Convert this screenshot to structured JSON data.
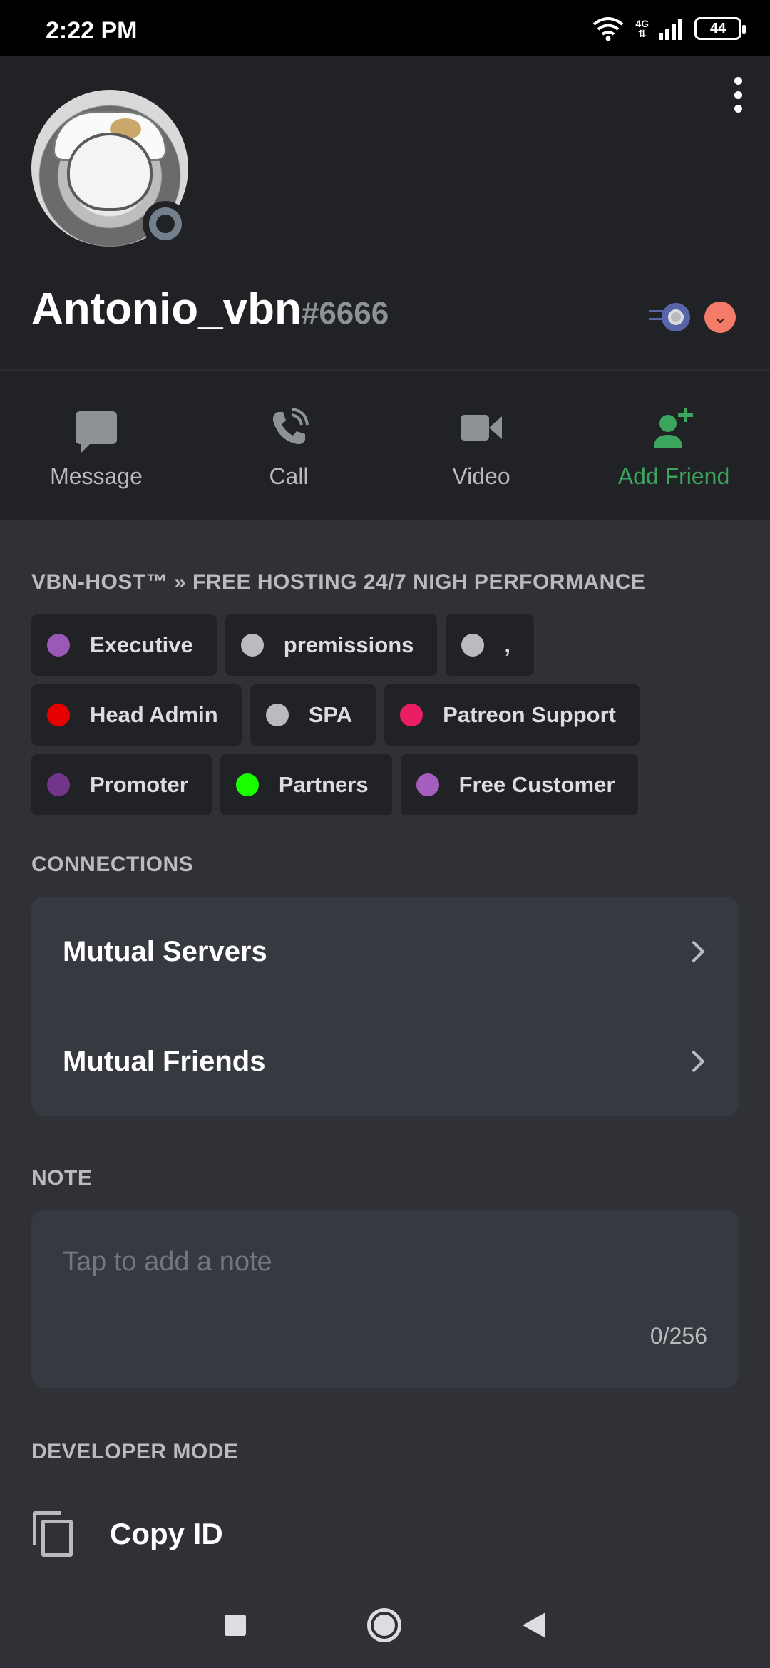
{
  "status_bar": {
    "time": "2:22 PM",
    "network": "4G",
    "battery": "44",
    "icons": [
      "wifi-icon",
      "signal-icon",
      "battery-icon"
    ]
  },
  "profile": {
    "username": "Antonio_vbn",
    "discriminator": "#6666",
    "status": "offline",
    "badges": [
      "nitro-boost-badge",
      "hypesquad-badge"
    ]
  },
  "actions": [
    {
      "label": "Message",
      "icon": "message-icon"
    },
    {
      "label": "Call",
      "icon": "call-icon"
    },
    {
      "label": "Video",
      "icon": "video-icon"
    },
    {
      "label": "Add Friend",
      "icon": "add-friend-icon"
    }
  ],
  "server_section": {
    "title": "VBN-HOST™ » FREE HOSTING 24/7 NIGH PERFORMANCE",
    "roles": [
      {
        "name": "Executive",
        "color": "#9b59b6"
      },
      {
        "name": "premissions",
        "color": "#b9bbbe"
      },
      {
        "name": ",",
        "color": "#b9bbbe"
      },
      {
        "name": "Head Admin",
        "color": "#e60000"
      },
      {
        "name": "SPA",
        "color": "#b9bbbe"
      },
      {
        "name": "Patreon Support",
        "color": "#e91e63"
      },
      {
        "name": "Promoter",
        "color": "#71368a"
      },
      {
        "name": "Partners",
        "color": "#1aff00"
      },
      {
        "name": "Free Customer",
        "color": "#a55dbf"
      }
    ]
  },
  "connections": {
    "title": "CONNECTIONS",
    "items": [
      {
        "label": "Mutual Servers"
      },
      {
        "label": "Mutual Friends"
      }
    ]
  },
  "note": {
    "title": "NOTE",
    "placeholder": "Tap to add a note",
    "counter": "0/256"
  },
  "developer": {
    "title": "DEVELOPER MODE",
    "copy_label": "Copy ID"
  },
  "colors": {
    "background": "#2f3136",
    "header": "#202225",
    "card": "#36393f",
    "accent_green": "#3ba55d"
  }
}
